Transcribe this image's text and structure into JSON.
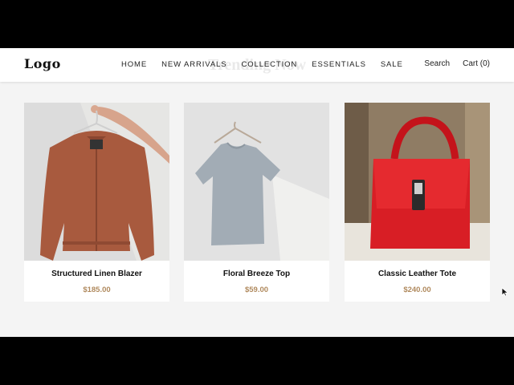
{
  "header": {
    "logo": "Logo",
    "section_title": "Trending Now",
    "nav": [
      "HOME",
      "NEW ARRIVALS",
      "COLLECTION",
      "ESSENTIALS",
      "SALE"
    ],
    "search_label": "Search",
    "cart_label": "Cart (0)"
  },
  "products": [
    {
      "name": "Structured Linen Blazer",
      "price": "$185.00"
    },
    {
      "name": "Floral Breeze Top",
      "price": "$59.00"
    },
    {
      "name": "Classic Leather Tote",
      "price": "$240.00"
    }
  ],
  "colors": {
    "price": "#b08a5e",
    "background": "#f4f4f4"
  }
}
